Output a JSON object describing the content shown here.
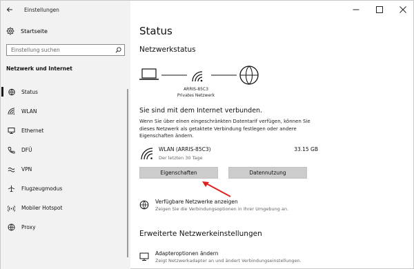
{
  "window": {
    "app_title": "Einstellungen"
  },
  "sidebar": {
    "home_label": "Startseite",
    "search_placeholder": "Einstellung suchen",
    "section_label": "Netzwerk und Internet",
    "items": [
      {
        "label": "Status",
        "icon": "home-globe-icon",
        "active": true
      },
      {
        "label": "WLAN",
        "icon": "wifi-icon"
      },
      {
        "label": "Ethernet",
        "icon": "ethernet-icon"
      },
      {
        "label": "DFÜ",
        "icon": "phone-icon"
      },
      {
        "label": "VPN",
        "icon": "vpn-icon"
      },
      {
        "label": "Flugzeugmodus",
        "icon": "airplane-icon"
      },
      {
        "label": "Mobiler Hotspot",
        "icon": "hotspot-icon"
      },
      {
        "label": "Proxy",
        "icon": "globe-icon"
      }
    ]
  },
  "main": {
    "title": "Status",
    "subtitle": "Netzwerkstatus",
    "network_name": "ARRIS-85C3",
    "network_type": "Privates Netzwerk",
    "connected_text": "Sie sind mit dem Internet verbunden.",
    "description": "Wenn Sie über einen eingeschränkten Datentarif verfügen, können Sie dieses Netzwerk als getaktete Verbindung festlegen oder andere Eigenschaften ändern.",
    "wlan": {
      "name": "WLAN (ARRIS-85C3)",
      "period": "Der letzten 30 Tage",
      "usage": "33.15 GB"
    },
    "buttons": {
      "properties": "Eigenschaften",
      "data_usage": "Datennutzung"
    },
    "available_networks": {
      "title": "Verfügbare Netzwerke anzeigen",
      "subtitle": "Zeigen Sie die Verbindungsoptionen in Ihrer Umgebung an."
    },
    "advanced_title": "Erweiterte Netzwerkeinstellungen",
    "adapter_options": {
      "title": "Adapteroptionen ändern",
      "subtitle": "Zeigt Netzwerkadapter an und ändert Verbindungseinstellungen."
    }
  },
  "colors": {
    "sidebar_bg": "#f2f2f2",
    "button_bg": "#cccccc",
    "annotation_arrow": "#e0201c"
  }
}
